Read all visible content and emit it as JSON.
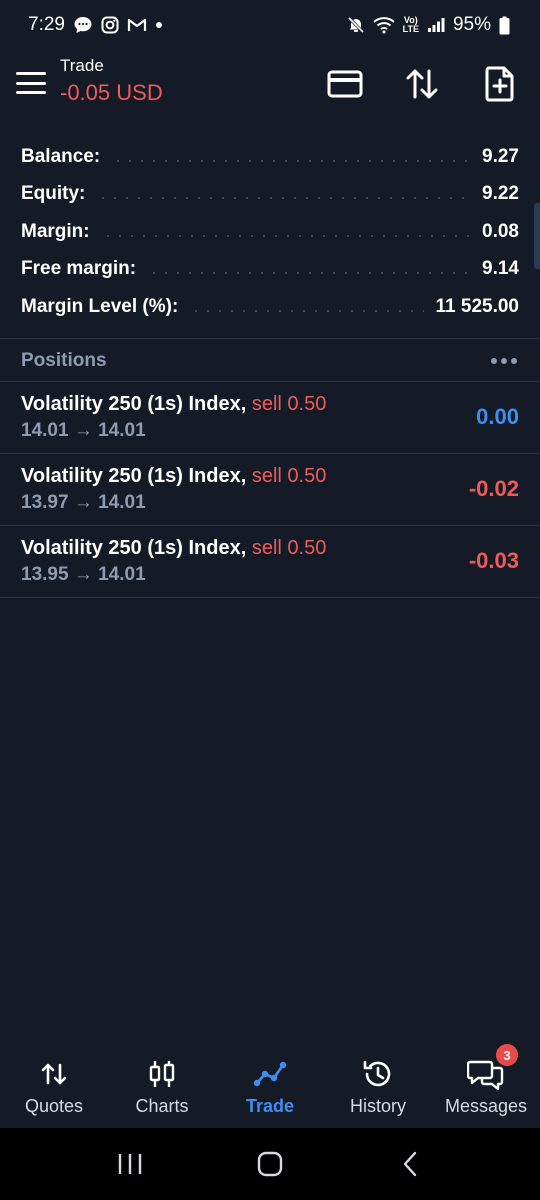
{
  "status_bar": {
    "time": "7:29",
    "battery": "95%",
    "lte_label": "LTE"
  },
  "header": {
    "title": "Trade",
    "profit": "-0.05 USD"
  },
  "account": {
    "rows": [
      {
        "label": "Balance:",
        "value": "9.27"
      },
      {
        "label": "Equity:",
        "value": "9.22"
      },
      {
        "label": "Margin:",
        "value": "0.08"
      },
      {
        "label": "Free margin:",
        "value": "9.14"
      },
      {
        "label": "Margin Level (%):",
        "value": "11 525.00"
      }
    ]
  },
  "positions": {
    "title": "Positions",
    "items": [
      {
        "symbol": "Volatility 250 (1s) Index,",
        "side": "sell 0.50",
        "prices": "14.01 → 14.01",
        "profit": "0.00"
      },
      {
        "symbol": "Volatility 250 (1s) Index,",
        "side": "sell 0.50",
        "prices": "13.97 → 14.01",
        "profit": "-0.02"
      },
      {
        "symbol": "Volatility 250 (1s) Index,",
        "side": "sell 0.50",
        "prices": "13.95 → 14.01",
        "profit": "-0.03"
      }
    ]
  },
  "nav": {
    "items": [
      {
        "label": "Quotes",
        "icon": "quotes-icon"
      },
      {
        "label": "Charts",
        "icon": "charts-icon"
      },
      {
        "label": "Trade",
        "icon": "trade-icon",
        "active": true
      },
      {
        "label": "History",
        "icon": "history-icon"
      },
      {
        "label": "Messages",
        "icon": "messages-icon",
        "badge": "3"
      }
    ]
  },
  "colors": {
    "background": "#141b26",
    "negative": "#f05a5a",
    "accent": "#3d8ef0",
    "muted": "#8e9bb0"
  }
}
